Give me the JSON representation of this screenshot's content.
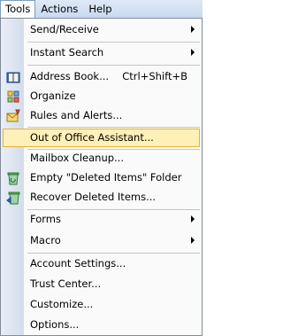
{
  "menubar": {
    "items": [
      {
        "label": "Tools"
      },
      {
        "label": "Actions"
      },
      {
        "label": "Help"
      }
    ]
  },
  "menu": {
    "items": [
      {
        "label": "Send/Receive",
        "submenu": true
      },
      {
        "label": "Instant Search",
        "submenu": true
      },
      {
        "label": "Address Book...",
        "shortcut": "Ctrl+Shift+B",
        "icon": "address-book-icon"
      },
      {
        "label": "Organize",
        "icon": "organize-icon"
      },
      {
        "label": "Rules and Alerts...",
        "icon": "rules-alerts-icon"
      },
      {
        "label": "Out of Office Assistant...",
        "highlighted": true
      },
      {
        "label": "Mailbox Cleanup..."
      },
      {
        "label": "Empty \"Deleted Items\" Folder",
        "icon": "recycle-bin-icon"
      },
      {
        "label": "Recover Deleted Items...",
        "icon": "recover-icon"
      },
      {
        "label": "Forms",
        "submenu": true
      },
      {
        "label": "Macro",
        "submenu": true
      },
      {
        "label": "Account Settings..."
      },
      {
        "label": "Trust Center..."
      },
      {
        "label": "Customize..."
      },
      {
        "label": "Options..."
      }
    ]
  },
  "colors": {
    "highlight_fill": "#fff0b8",
    "highlight_border": "#e0b23e",
    "menubar_bg": "#dfe9f6"
  }
}
